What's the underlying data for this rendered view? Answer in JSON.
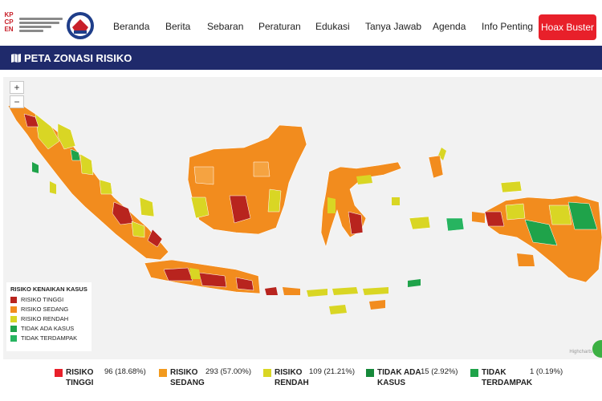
{
  "header": {
    "logo_text": [
      "K",
      "P",
      "C",
      "P",
      "E",
      "N"
    ],
    "nav": [
      "Beranda",
      "Berita",
      "Sebaran",
      "Peraturan",
      "Edukasi",
      "Tanya Jawab",
      "Agenda",
      "Info Penting"
    ],
    "hoax_button": "Hoax Buster"
  },
  "section": {
    "title": "PETA ZONASI RISIKO",
    "icon": "map-icon"
  },
  "map": {
    "zoom_in": "+",
    "zoom_out": "−",
    "credit": "Highcharts",
    "legend_title": "RISIKO KENAIKAN KASUS",
    "legend": [
      {
        "label": "RISIKO TINGGI",
        "color": "#b8241e"
      },
      {
        "label": "RISIKO SEDANG",
        "color": "#f28c1e"
      },
      {
        "label": "RISIKO RENDAH",
        "color": "#d9d624"
      },
      {
        "label": "TIDAK ADA KASUS",
        "color": "#1fa34a"
      },
      {
        "label": "TIDAK TERDAMPAK",
        "color": "#27b460"
      }
    ]
  },
  "stats": [
    {
      "label": "RISIKO TINGGI",
      "value": "96 (18.68%)",
      "color": "#e8202a"
    },
    {
      "label": "RISIKO SEDANG",
      "value": "293 (57.00%)",
      "color": "#f29a1e"
    },
    {
      "label": "RISIKO RENDAH",
      "value": "109 (21.21%)",
      "color": "#d9d624"
    },
    {
      "label": "TIDAK ADA KASUS",
      "value": "15 (2.92%)",
      "color": "#16893a"
    },
    {
      "label": "TIDAK TERDAMPAK",
      "value": "1 (0.19%)",
      "color": "#1fa34a"
    }
  ]
}
